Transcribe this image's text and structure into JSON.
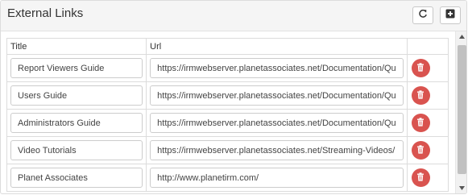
{
  "panel": {
    "title": "External Links"
  },
  "toolbar": {
    "refresh_icon": "refresh-icon",
    "add_icon": "plus-square-icon"
  },
  "table": {
    "headers": [
      "Title",
      "Url",
      ""
    ],
    "rows": [
      {
        "title": "Report Viewers Guide",
        "url": "https://irmwebserver.planetassociates.net/Documentation/Qu"
      },
      {
        "title": "Users Guide",
        "url": "https://irmwebserver.planetassociates.net/Documentation/Qu"
      },
      {
        "title": "Administrators Guide",
        "url": "https://irmwebserver.planetassociates.net/Documentation/Qu"
      },
      {
        "title": "Video Tutorials",
        "url": "https://irmwebserver.planetassociates.net/Streaming-Videos/"
      },
      {
        "title": "Planet Associates",
        "url": "http://www.planetirm.com/"
      }
    ]
  },
  "colors": {
    "delete": "#d9534f",
    "header_bg": "#f5f5f5",
    "border": "#dcdcdc"
  }
}
